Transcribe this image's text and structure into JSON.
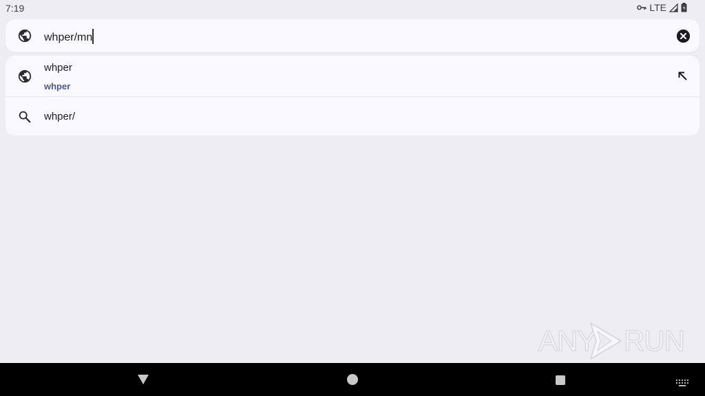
{
  "status_bar": {
    "time": "7:19",
    "network": "LTE",
    "icons": [
      "vpn-key-icon",
      "signal-icon",
      "battery-icon"
    ]
  },
  "search": {
    "value": "whper/mn",
    "icon": "globe-icon",
    "clear_icon": "clear-icon"
  },
  "suggestions": [
    {
      "icon": "globe-icon",
      "title": "whper",
      "subtitle": "whper",
      "action_icon": "arrow-up-left-icon"
    },
    {
      "icon": "search-icon",
      "title": "whper/"
    }
  ],
  "watermark": {
    "left": "ANY",
    "right": "RUN"
  },
  "navigation": {
    "buttons": [
      "back",
      "home",
      "recents",
      "keyboard"
    ]
  },
  "colors": {
    "background": "#efedf4",
    "surface": "#faf8ff",
    "subtitle_accent": "#4a5a8c",
    "nav_bar": "#000000"
  }
}
